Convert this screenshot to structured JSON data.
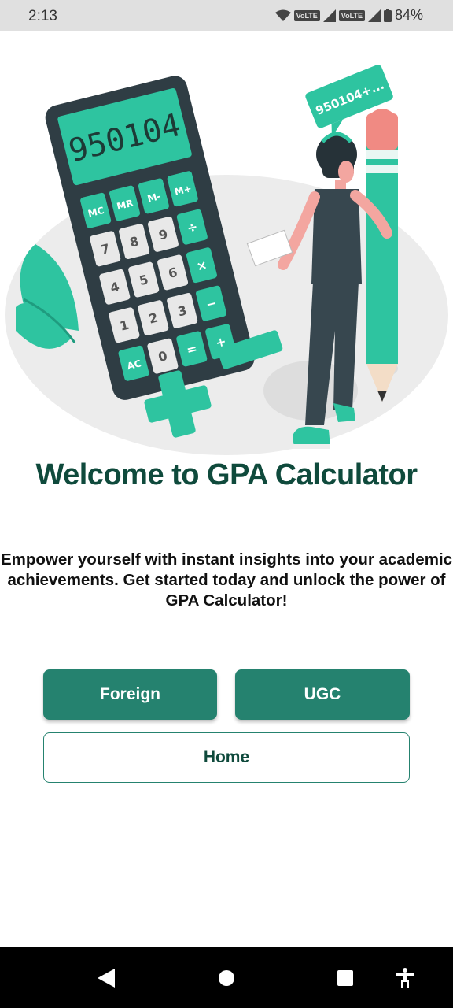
{
  "status_bar": {
    "time": "2:13",
    "volte1": "VoLTE",
    "volte2": "VoLTE",
    "battery": "84%"
  },
  "illustration": {
    "calculator_display": "950104",
    "speech_bubble": "950104+...",
    "keys": [
      "MC",
      "MR",
      "M-",
      "M+",
      "7",
      "8",
      "9",
      "÷",
      "4",
      "5",
      "6",
      "×",
      "1",
      "2",
      "3",
      "−",
      "AC",
      "0",
      "=",
      "+"
    ]
  },
  "welcome": {
    "title": "Welcome to GPA Calculator",
    "description": "Empower yourself with instant insights into your academic achievements. Get started today and unlock the power of GPA Calculator!"
  },
  "buttons": {
    "foreign": "Foreign",
    "ugc": "UGC",
    "home": "Home"
  },
  "colors": {
    "accent": "#25826f",
    "title": "#0f4a3c",
    "teal_illustration": "#2ec4a0"
  }
}
